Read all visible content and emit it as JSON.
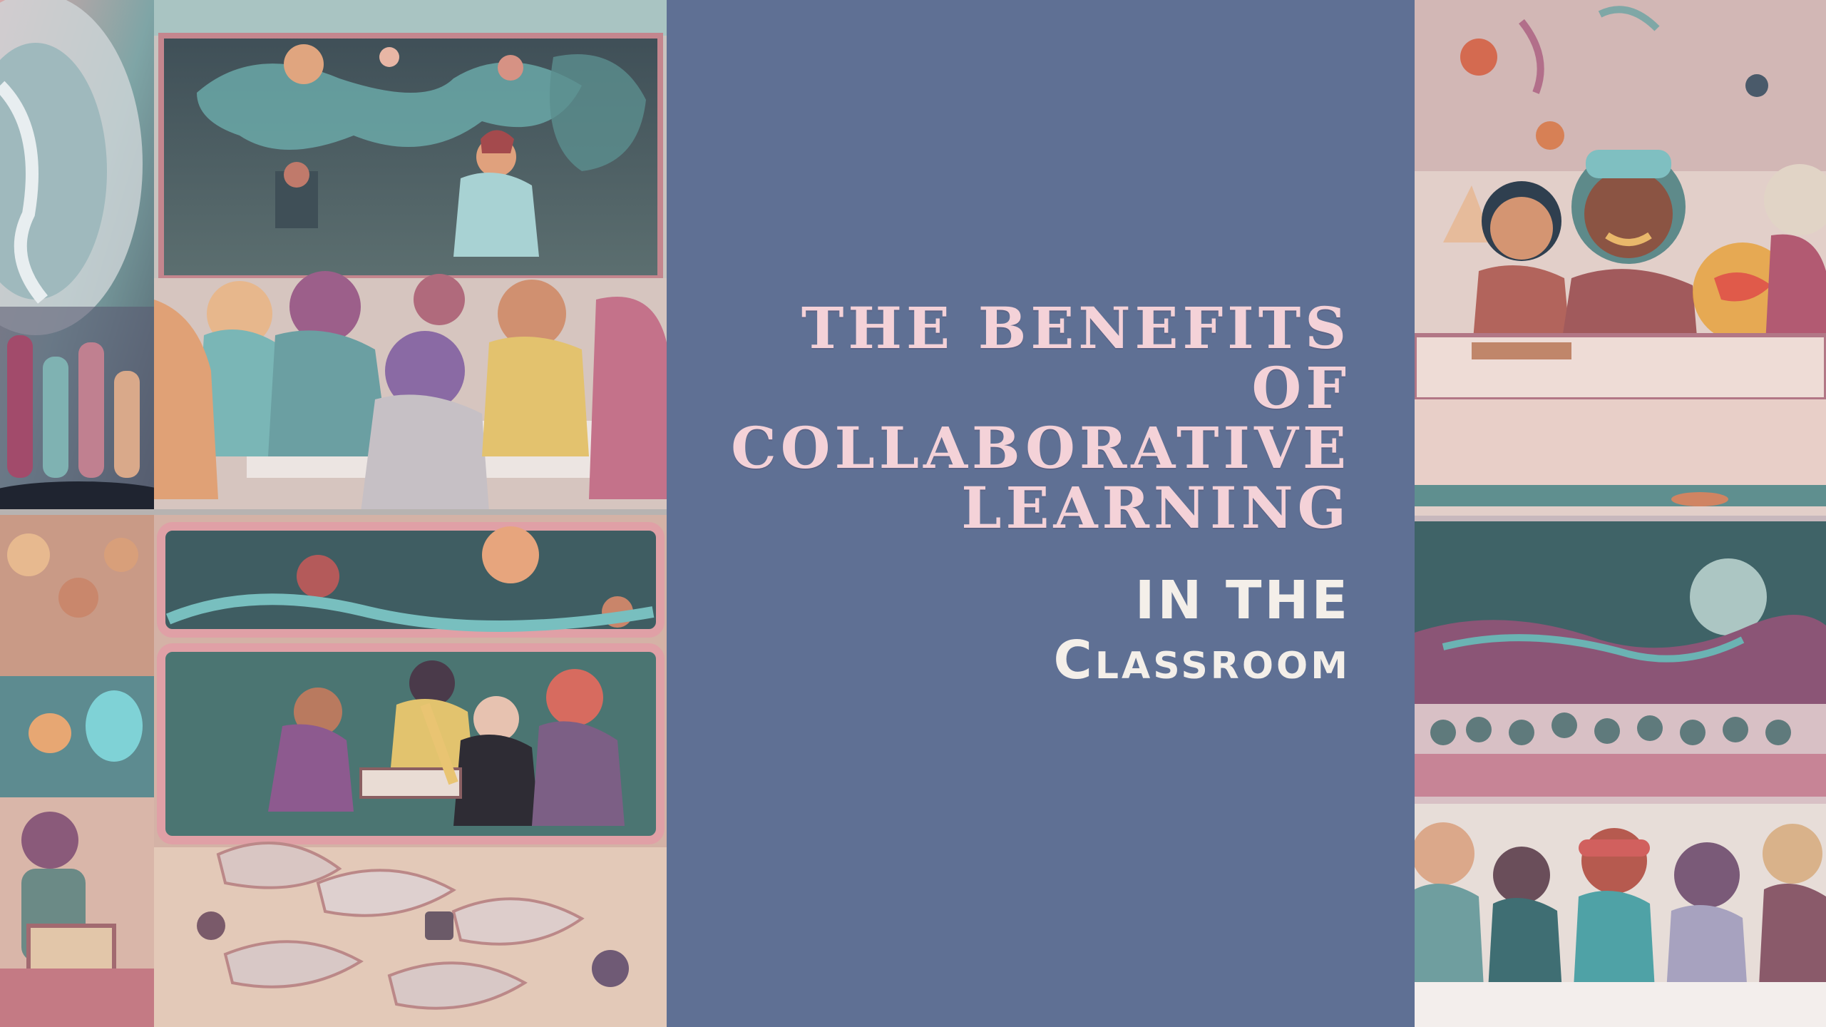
{
  "slide": {
    "title_lines": [
      "The Benefits",
      "of",
      "Collaborative",
      "Learning"
    ],
    "subtitle_lines": [
      "in the",
      "Classroom"
    ]
  },
  "colors": {
    "background": "#5f7094",
    "title": "#f4d2d8",
    "subtitle": "#f4efe9"
  },
  "images": [
    "classroom-illustration-left-strip-top",
    "classroom-illustration-left-strip-bottom",
    "classroom-illustration-teacher-lecture",
    "classroom-illustration-group-reading",
    "classroom-illustration-students-at-desk",
    "classroom-illustration-students-headphones"
  ]
}
